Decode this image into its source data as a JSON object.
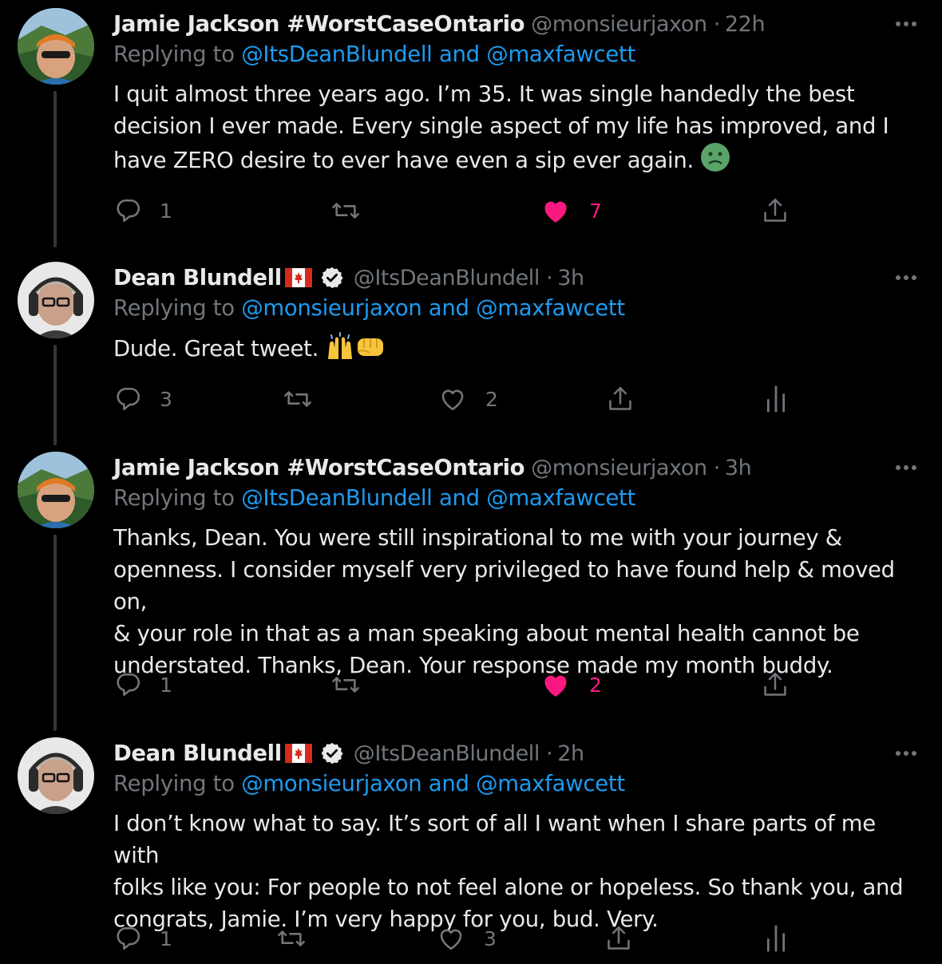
{
  "tweets": [
    {
      "author": "Jamie Jackson #WorstCaseOntario",
      "handle": "@monsieurjaxon",
      "separator": "·",
      "time": "22h",
      "replying_label": "Replying to",
      "replying_to": "@ItsDeanBlundell and @maxfawcett",
      "lines": [
        "I quit almost three years ago. I’m 35. It was single handedly the best",
        "decision I ever made. Every single aspect of my life has improved, and I",
        "have ZERO desire to ever have even a sip ever again."
      ],
      "trailing_emoji": "nauseated-face",
      "replies": "1",
      "likes": "7",
      "liked": true
    },
    {
      "author": "Dean Blundell",
      "flag": "canada-flag",
      "verified": true,
      "handle": "@ItsDeanBlundell",
      "separator": "·",
      "time": "3h",
      "replying_label": "Replying to",
      "replying_to": "@monsieurjaxon and @maxfawcett",
      "lines": [
        "Dude. Great tweet."
      ],
      "trailing_emoji": "raised-hands oncoming-fist",
      "replies": "3",
      "likes": "2",
      "liked": false
    },
    {
      "author": "Jamie Jackson #WorstCaseOntario",
      "handle": "@monsieurjaxon",
      "separator": "·",
      "time": "3h",
      "replying_label": "Replying to",
      "replying_to": "@ItsDeanBlundell and @maxfawcett",
      "lines": [
        "Thanks, Dean. You were still inspirational to me with your journey &",
        "openness. I consider myself very privileged to have found help & moved on,",
        "& your role in that as a man speaking about mental health cannot be",
        "understated. Thanks, Dean. Your response made my month buddy."
      ],
      "replies": "1",
      "likes": "2",
      "liked": true
    },
    {
      "author": "Dean Blundell",
      "flag": "canada-flag",
      "verified": true,
      "handle": "@ItsDeanBlundell",
      "separator": "·",
      "time": "2h",
      "replying_label": "Replying to",
      "replying_to": "@monsieurjaxon and @maxfawcett",
      "lines": [
        "I don’t know what to say. It’s sort of all I want when I share parts of me with",
        "folks like you: For people to not feel alone or hopeless. So thank you, and",
        "congrats, Jamie. I’m very happy for you, bud. Very."
      ],
      "replies": "1",
      "likes": "3",
      "liked": false
    }
  ],
  "colors": {
    "background": "#000000",
    "text": "#e7e9ea",
    "muted": "#71767b",
    "link": "#1d9bf0",
    "like": "#f91880",
    "thread_line": "#333639"
  }
}
